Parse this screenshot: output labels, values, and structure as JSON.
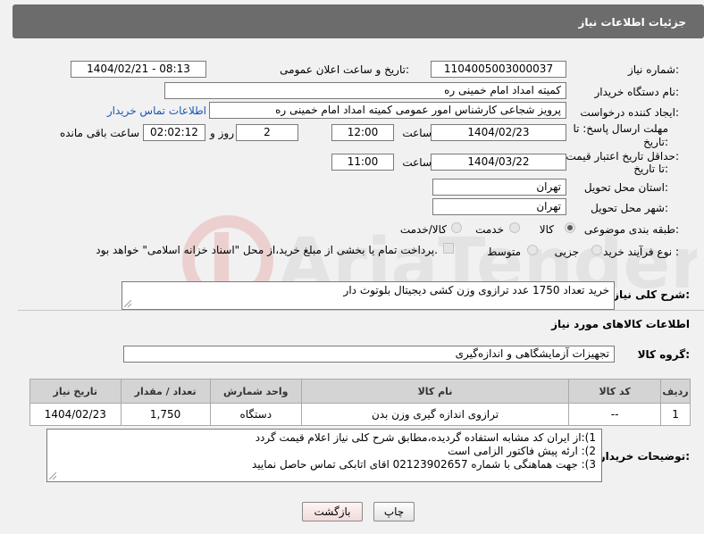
{
  "header": {
    "title": "جزئیات اطلاعات نیاز"
  },
  "need_number": {
    "label": "شماره نیاز:",
    "value": "1104005003000037"
  },
  "announce": {
    "label": "تاریخ و ساعت اعلان عمومی:",
    "value": "1404/02/21 - 08:13"
  },
  "buyer_org": {
    "label": "نام دستگاه خریدار:",
    "value": "کمیته امداد امام خمینی ره"
  },
  "requester": {
    "label": "ایجاد کننده درخواست:",
    "value": "پرویز شجاعی کارشناس امور عمومی کمیته امداد امام خمینی ره",
    "contact_link": "اطلاعات تماس خریدار"
  },
  "reply_deadline": {
    "label_line1": "مهلت ارسال پاسخ: تا",
    "label_line2": "تاریخ:",
    "date": "1404/02/23",
    "time_label": "ساعت",
    "time": "12:00",
    "days": "2",
    "days_label": "روز و",
    "remaining": "02:02:12",
    "remaining_label": "ساعت باقی مانده"
  },
  "price_validity": {
    "label_line1": "حداقل تاریخ اعتبار قیمت:",
    "label_line2": "تا تاریخ:",
    "date": "1404/03/22",
    "time_label": "ساعت",
    "time": "11:00"
  },
  "delivery_province": {
    "label": "استان محل تحویل:",
    "value": "تهران"
  },
  "delivery_city": {
    "label": "شهر محل تحویل:",
    "value": "تهران"
  },
  "category": {
    "label": "طبقه بندی موضوعی:",
    "options": [
      "کالا",
      "خدمت",
      "کالا/خدمت"
    ],
    "selected": "کالا"
  },
  "purchase_type": {
    "label": "نوع فرآیند خرید :",
    "options": [
      "جزیی",
      "متوسط"
    ],
    "note": "پرداخت تمام یا بخشی از مبلغ خرید،از محل \"اسناد خزانه اسلامی\" خواهد بود."
  },
  "description": {
    "label": "شرح کلی نیاز:",
    "value": "خرید تعداد 1750 عدد ترازوی وزن کشی دیجیتال بلوتوث دار"
  },
  "goods_section": {
    "title": "اطلاعات کالاهای مورد نیاز"
  },
  "goods_group": {
    "label": "گروه کالا:",
    "value": "تجهیزات آزمایشگاهی و اندازه‌گیری"
  },
  "table": {
    "headers": [
      "ردیف",
      "کد کالا",
      "نام کالا",
      "واحد شمارش",
      "تعداد / مقدار",
      "تاریخ نیاز"
    ],
    "rows": [
      [
        "1",
        "--",
        "ترازوی اندازه گیری وزن بدن",
        "دستگاه",
        "1,750",
        "1404/02/23"
      ]
    ]
  },
  "buyer_notes": {
    "label": "توضیحات خریدار:",
    "lines": [
      "1):از ایران کد مشابه استفاده گردیده،مطابق شرح کلی نیاز اعلام قیمت گردد",
      "2): ارئه پیش فاکتور الزامی است",
      "3): جهت هماهنگی با شماره 02123902657 اقای اتابکی تماس حاصل نمایید"
    ]
  },
  "buttons": {
    "print": "چاپ",
    "back": "بازگشت"
  },
  "watermark": {
    "icon": "ariatender-logo",
    "text": "AriaTender.neT"
  }
}
